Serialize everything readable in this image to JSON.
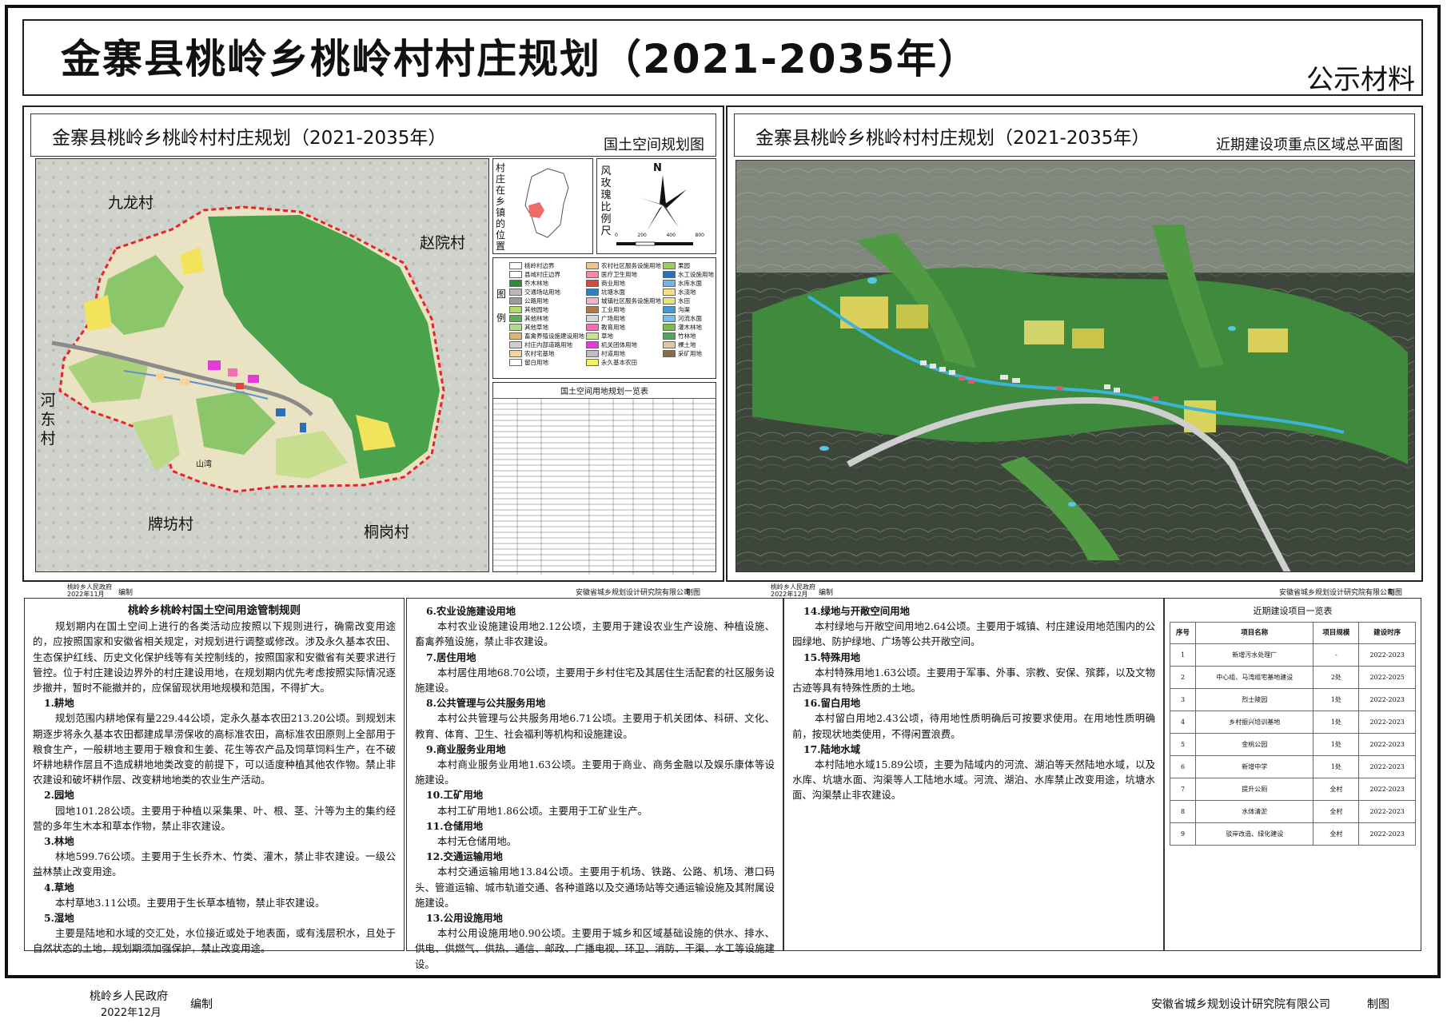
{
  "header": {
    "title": "金寨县桃岭乡桃岭村村庄规划（2021-2035年）",
    "badge": "公示材料"
  },
  "left_panel": {
    "title": "金寨县桃岭乡桃岭村村庄规划（2021-2035年）",
    "subtitle": "国土空间规划图",
    "map_labels": {
      "jiulong": "九龙村",
      "zhaoyuan": "赵院村",
      "hedong": "河东村",
      "paifang": "牌坊村",
      "tonggang": "桐岗村",
      "shanwan": "山湾"
    },
    "inset_label": "村庄在乡镇的位置",
    "rose_label": "风玫瑰比例尺",
    "north": "N",
    "scale_ticks": [
      "0",
      "200",
      "400",
      "800"
    ],
    "legend_label": "图例",
    "legend_items": [
      {
        "label": "桃岭村边界",
        "color": "#ffffff"
      },
      {
        "label": "农村社区服务设施用地",
        "color": "#f2c38a"
      },
      {
        "label": "果园",
        "color": "#9ecf56"
      },
      {
        "label": "县域村庄边界",
        "color": "#ffffff"
      },
      {
        "label": "医疗卫生用地",
        "color": "#f48aa6"
      },
      {
        "label": "水工设施用地",
        "color": "#2d6fb7"
      },
      {
        "label": "乔木林地",
        "color": "#2e8b3a"
      },
      {
        "label": "商业用地",
        "color": "#e0473c"
      },
      {
        "label": "水库水面",
        "color": "#6db5e3"
      },
      {
        "label": "交通场站用地",
        "color": "#b9b9b9"
      },
      {
        "label": "坑塘水面",
        "color": "#2f7fc4"
      },
      {
        "label": "水浇地",
        "color": "#f5e08a"
      },
      {
        "label": "公路用地",
        "color": "#9a9a9a"
      },
      {
        "label": "城镇社区服务设施用地",
        "color": "#f0b4d0"
      },
      {
        "label": "水田",
        "color": "#e8e37a"
      },
      {
        "label": "其他园地",
        "color": "#b6d96b"
      },
      {
        "label": "工业用地",
        "color": "#b17a4e"
      },
      {
        "label": "沟渠",
        "color": "#4a98d3"
      },
      {
        "label": "其他林地",
        "color": "#5fae4f"
      },
      {
        "label": "广场用地",
        "color": "#d6d6d6"
      },
      {
        "label": "河流水面",
        "color": "#6ec1ea"
      },
      {
        "label": "其他草地",
        "color": "#b3d98a"
      },
      {
        "label": "教育用地",
        "color": "#f46fb1"
      },
      {
        "label": "灌木林地",
        "color": "#7dbb52"
      },
      {
        "label": "畜禽养殖设施建设用地",
        "color": "#e2b56a"
      },
      {
        "label": "草地",
        "color": "#c9e48c"
      },
      {
        "label": "竹林地",
        "color": "#4ba75f"
      },
      {
        "label": "村庄内部道路用地",
        "color": "#cfcfcf"
      },
      {
        "label": "机关团体用地",
        "color": "#e23bd6"
      },
      {
        "label": "裸土地",
        "color": "#d9c9a8"
      },
      {
        "label": "农村宅基地",
        "color": "#f7d39a"
      },
      {
        "label": "村道用地",
        "color": "#bdbdbd"
      },
      {
        "label": "采矿用地",
        "color": "#8b6a4a"
      },
      {
        "label": "留白用地",
        "color": "#ffffff"
      },
      {
        "label": "永久基本农田",
        "color": "#f2f260"
      }
    ],
    "table_title": "国土空间用地规划一览表",
    "credit_left": "桃岭乡人民政府\n2022年11月",
    "credit_left_action": "编制",
    "credit_right": "安徽省城乡规划设计研究院有限公司",
    "credit_right_action": "制图"
  },
  "right_panel": {
    "title": "金寨县桃岭乡桃岭村村庄规划（2021-2035年）",
    "subtitle": "近期建设项重点区域总平面图",
    "credit_left": "桃岭乡人民政府\n2022年12月",
    "credit_left_action": "编制",
    "credit_right": "安徽省城乡规划设计研究院有限公司",
    "credit_right_action": "制图"
  },
  "rules": {
    "heading": "桃岭乡桃岭村国土空间用途管制规则",
    "intro": "规划期内在国土空间上进行的各类活动应按照以下规则进行，确需改变用途的，应按照国家和安徽省相关规定，对规划进行调整或修改。涉及永久基本农田、生态保护红线、历史文化保护线等有关控制线的，按照国家和安徽省有关要求进行管控。位于村庄建设边界外的村庄建设用地，在规划期内优先考虑按照实际情况逐步撤并，暂时不能撤并的，应保留现状用地规模和范围，不得扩大。",
    "col1": [
      {
        "head": "1.耕地",
        "body": "规划范围内耕地保有量229.44公顷，定永久基本农田213.20公顷。到规划末期逐步将永久基本农田都建成旱涝保收的高标准农田，高标准农田原则上全部用于粮食生产，一般耕地主要用于粮食和生姜、花生等农产品及饲草饲料生产，在不破坏耕地耕作层且不造成耕地地类改变的前提下，可以适度种植其他农作物。禁止非农建设和破坏耕作层、改变耕地地类的农业生产活动。"
      },
      {
        "head": "2.园地",
        "body": "园地101.28公顷。主要用于种植以采集果、叶、根、茎、汁等为主的集约经营的多年生木本和草本作物，禁止非农建设。"
      },
      {
        "head": "3.林地",
        "body": "林地599.76公顷。主要用于生长乔木、竹类、灌木，禁止非农建设。一级公益林禁止改变用途。"
      },
      {
        "head": "4.草地",
        "body": "本村草地3.11公顷。主要用于生长草本植物，禁止非农建设。"
      },
      {
        "head": "5.湿地",
        "body": "主要是陆地和水域的交汇处，水位接近或处于地表面，或有浅层积水，且处于自然状态的土地，规划期须加强保护，禁止改变用途。"
      }
    ],
    "col2": [
      {
        "head": "6.农业设施建设用地",
        "body": "本村农业设施建设用地2.12公顷，主要用于建设农业生产设施、种植设施、畜禽养殖设施，禁止非农建设。"
      },
      {
        "head": "7.居住用地",
        "body": "本村居住用地68.70公顷，主要用于乡村住宅及其居住生活配套的社区服务设施建设。"
      },
      {
        "head": "8.公共管理与公共服务用地",
        "body": "本村公共管理与公共服务用地6.71公顷。主要用于机关团体、科研、文化、教育、体育、卫生、社会福利等机构和设施建设。"
      },
      {
        "head": "9.商业服务业用地",
        "body": "本村商业服务业用地1.63公顷。主要用于商业、商务金融以及娱乐康体等设施建设。"
      },
      {
        "head": "10.工矿用地",
        "body": "本村工矿用地1.86公顷。主要用于工矿业生产。"
      },
      {
        "head": "11.仓储用地",
        "body": "本村无仓储用地。"
      },
      {
        "head": "12.交通运输用地",
        "body": "本村交通运输用地13.84公顷。主要用于机场、铁路、公路、机场、港口码头、管道运输、城市轨道交通、各种道路以及交通场站等交通运输设施及其附属设施建设。"
      },
      {
        "head": "13.公用设施用地",
        "body": "本村公用设施用地0.90公顷。主要用于城乡和区域基础设施的供水、排水、供电、供燃气、供热、通信、邮政、广播电视、环卫、消防、干渠、水工等设施建设。"
      }
    ],
    "col3": [
      {
        "head": "14.绿地与开敞空间用地",
        "body": "本村绿地与开敞空间用地2.64公顷。主要用于城镇、村庄建设用地范围内的公园绿地、防护绿地、广场等公共开敞空间。"
      },
      {
        "head": "15.特殊用地",
        "body": "本村特殊用地1.63公顷。主要用于军事、外事、宗教、安保、殡葬，以及文物古迹等具有特殊性质的土地。"
      },
      {
        "head": "16.留白用地",
        "body": "本村留白用地2.43公顷，待用地性质明确后可按要求使用。在用地性质明确前，按现状地类使用，不得闲置浪费。"
      },
      {
        "head": "17.陆地水域",
        "body": "本村陆地水域15.89公顷，主要为陆域内的河流、湖泊等天然陆地水域，以及水库、坑塘水面、沟渠等人工陆地水域。河流、湖泊、水库禁止改变用途，坑塘水面、沟渠禁止非农建设。"
      }
    ]
  },
  "projects": {
    "title": "近期建设项目一览表",
    "columns": [
      "序号",
      "项目名称",
      "项目规模",
      "建设时序"
    ],
    "rows": [
      [
        "1",
        "新增污水处理厂",
        "-",
        "2022-2023"
      ],
      [
        "2",
        "中心组、马湾组宅基地建设",
        "2处",
        "2022-2025"
      ],
      [
        "3",
        "烈士陵园",
        "1处",
        "2022-2023"
      ],
      [
        "4",
        "乡村振兴培训基地",
        "1处",
        "2022-2023"
      ],
      [
        "5",
        "金桃公园",
        "1处",
        "2022-2023"
      ],
      [
        "6",
        "新增中学",
        "1处",
        "2022-2023"
      ],
      [
        "7",
        "提升公厕",
        "全村",
        "2022-2023"
      ],
      [
        "8",
        "水体清淤",
        "全村",
        "2022-2023"
      ],
      [
        "9",
        "驳岸改造、绿化建设",
        "全村",
        "2022-2023"
      ]
    ]
  },
  "footer": {
    "org_left": "桃岭乡人民政府",
    "date_left": "2022年12月",
    "action_left": "编制",
    "org_right": "安徽省城乡规划设计研究院有限公司",
    "action_right": "制图"
  }
}
